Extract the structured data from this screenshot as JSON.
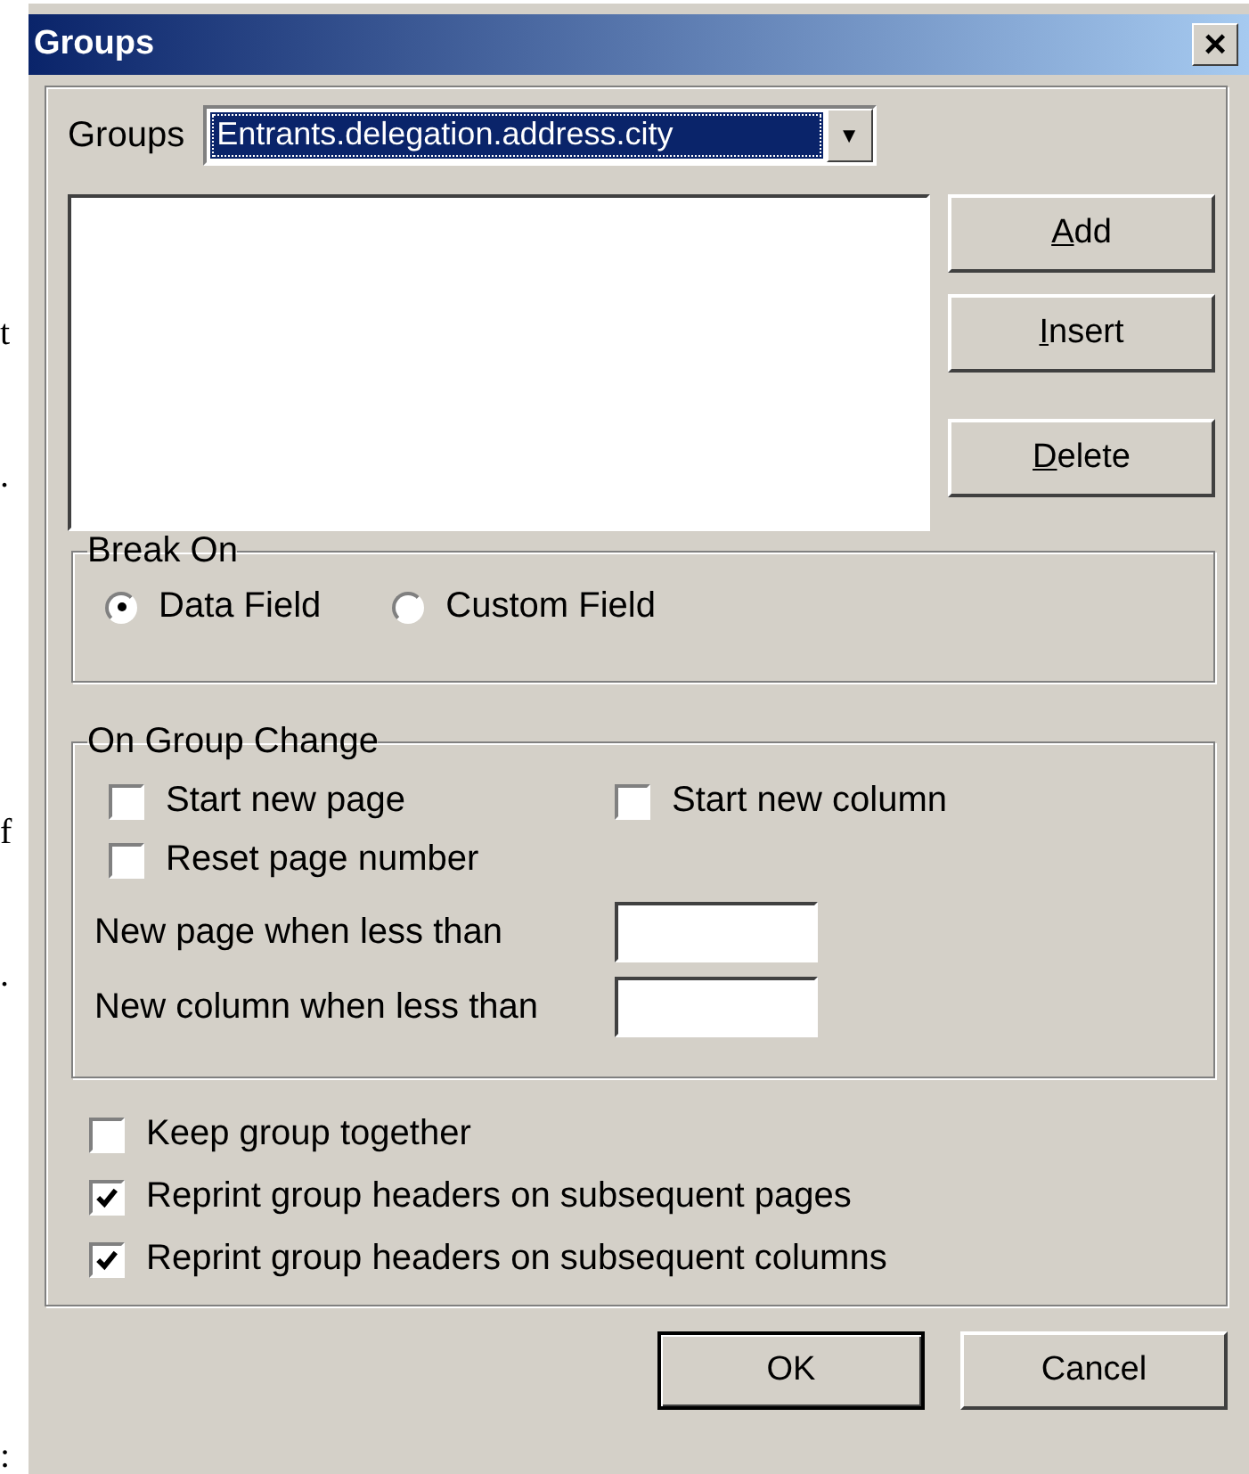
{
  "background_fragments": [
    "t",
    ".",
    "f",
    ".",
    ":"
  ],
  "window": {
    "title": "Groups",
    "close": "×"
  },
  "groups_field": {
    "label": "Groups",
    "value": "Entrants.delegation.address.city",
    "dropdown": "▼"
  },
  "side_buttons": [
    {
      "access_key": "A",
      "label_rest": "dd"
    },
    {
      "access_key": "I",
      "label_rest": "nsert"
    },
    {
      "access_key": "D",
      "label_rest": "elete"
    }
  ],
  "break_on": {
    "title": "Break On",
    "options": [
      {
        "label": "Data Field",
        "selected": true
      },
      {
        "label": "Custom Field",
        "selected": false
      }
    ]
  },
  "on_group_change": {
    "title": "On Group Change",
    "checkboxes": [
      {
        "label": "Start new page",
        "checked": false
      },
      {
        "label": "Start new column",
        "checked": false
      },
      {
        "label": "Reset page number",
        "checked": false
      }
    ],
    "fields": [
      {
        "label": "New page when less than"
      },
      {
        "label": "New column when less than"
      }
    ]
  },
  "options": [
    {
      "label": "Keep group together",
      "checked": false
    },
    {
      "label": "Reprint group headers on subsequent pages",
      "checked": true
    },
    {
      "label": "Reprint group headers on subsequent columns",
      "checked": true
    }
  ],
  "buttons": [
    {
      "label": "OK",
      "default": true
    },
    {
      "label": "Cancel",
      "default": false
    }
  ]
}
